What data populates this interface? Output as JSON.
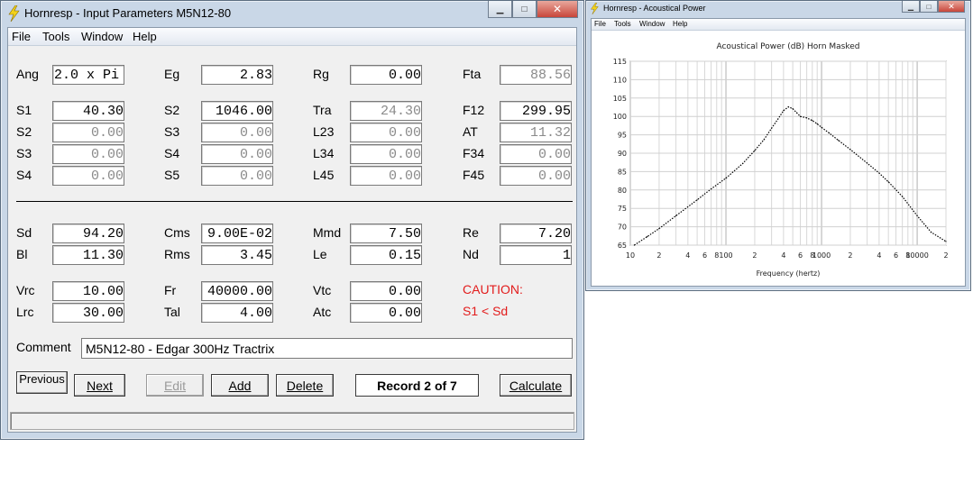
{
  "input_window": {
    "title": "Hornresp - Input Parameters   M5N12-80",
    "menu": [
      "File",
      "Tools",
      "Window",
      "Help"
    ],
    "rows": [
      [
        {
          "label": "Ang",
          "value": "2.0 x Pi",
          "style": "left"
        },
        {
          "label": "Eg",
          "value": "2.83"
        },
        {
          "label": "Rg",
          "value": "0.00"
        },
        {
          "label": "Fta",
          "value": "88.56",
          "style": "gray"
        }
      ],
      [
        {
          "label": "S1",
          "value": "40.30"
        },
        {
          "label": "S2",
          "value": "1046.00"
        },
        {
          "label": "Tra",
          "value": "24.30",
          "style": "gray"
        },
        {
          "label": "F12",
          "value": "299.95"
        }
      ],
      [
        {
          "label": "S2",
          "value": "0.00",
          "style": "gray"
        },
        {
          "label": "S3",
          "value": "0.00",
          "style": "gray"
        },
        {
          "label": "L23",
          "value": "0.00",
          "style": "gray"
        },
        {
          "label": "AT",
          "value": "11.32",
          "style": "gray"
        }
      ],
      [
        {
          "label": "S3",
          "value": "0.00",
          "style": "gray"
        },
        {
          "label": "S4",
          "value": "0.00",
          "style": "gray"
        },
        {
          "label": "L34",
          "value": "0.00",
          "style": "gray"
        },
        {
          "label": "F34",
          "value": "0.00",
          "style": "gray"
        }
      ],
      [
        {
          "label": "S4",
          "value": "0.00",
          "style": "gray"
        },
        {
          "label": "S5",
          "value": "0.00",
          "style": "gray"
        },
        {
          "label": "L45",
          "value": "0.00",
          "style": "gray"
        },
        {
          "label": "F45",
          "value": "0.00",
          "style": "gray"
        }
      ],
      [
        {
          "label": "Sd",
          "value": "94.20"
        },
        {
          "label": "Cms",
          "value": "9.00E-02"
        },
        {
          "label": "Mmd",
          "value": "7.50"
        },
        {
          "label": "Re",
          "value": "7.20"
        }
      ],
      [
        {
          "label": "Bl",
          "value": "11.30"
        },
        {
          "label": "Rms",
          "value": "3.45"
        },
        {
          "label": "Le",
          "value": "0.15"
        },
        {
          "label": "Nd",
          "value": "1"
        }
      ],
      [
        {
          "label": "Vrc",
          "value": "10.00"
        },
        {
          "label": "Fr",
          "value": "40000.00"
        },
        {
          "label": "Vtc",
          "value": "0.00"
        }
      ],
      [
        {
          "label": "Lrc",
          "value": "30.00"
        },
        {
          "label": "Tal",
          "value": "4.00"
        },
        {
          "label": "Atc",
          "value": "0.00"
        }
      ]
    ],
    "caution_title": "CAUTION:",
    "caution_text": "S1 < Sd",
    "comment_label": "Comment",
    "comment_value": "M5N12-80 - Edgar 300Hz Tractrix",
    "buttons": {
      "previous": "Previous",
      "next": "Next",
      "edit": "Edit",
      "add": "Add",
      "delete": "Delete",
      "calculate": "Calculate"
    },
    "record": "Record 2 of 7",
    "status": ""
  },
  "power_window": {
    "title": "Hornresp - Acoustical Power",
    "menu": [
      "File",
      "Tools",
      "Window",
      "Help"
    ]
  },
  "chart_data": {
    "type": "line",
    "title": "Acoustical Power (dB)   Horn   Masked",
    "xlabel": "Frequency (hertz)",
    "ylabel": "",
    "xscale": "log",
    "xlim": [
      10,
      20000
    ],
    "ylim": [
      65,
      115
    ],
    "grid": true,
    "x_tick_labels": [
      "10",
      "2",
      "4",
      "6",
      "8",
      "100",
      "2",
      "4",
      "6",
      "8",
      "1000",
      "2",
      "4",
      "6",
      "8",
      "10000",
      "2"
    ],
    "y_tick_labels": [
      "115",
      "110",
      "105",
      "100",
      "95",
      "90",
      "85",
      "80",
      "75",
      "70",
      "65"
    ],
    "series": [
      {
        "x": [
          11,
          15,
          20,
          30,
          50,
          70,
          100,
          150,
          200,
          250,
          300,
          350,
          400,
          450,
          500,
          550,
          600,
          700,
          800,
          900,
          1000,
          1200,
          1500,
          2000,
          3000,
          4000,
          5000,
          7000,
          10000,
          14000,
          20000
        ],
        "y": [
          65,
          67.3,
          69.5,
          73,
          77.3,
          80.3,
          83.2,
          87.2,
          90.7,
          93.7,
          96.8,
          99.3,
          101.6,
          102.6,
          102.1,
          101,
          100,
          99.6,
          98.9,
          98,
          97,
          95.5,
          93.5,
          91,
          87.3,
          84.6,
          82.2,
          78.2,
          73,
          68.5,
          66
        ]
      }
    ]
  }
}
